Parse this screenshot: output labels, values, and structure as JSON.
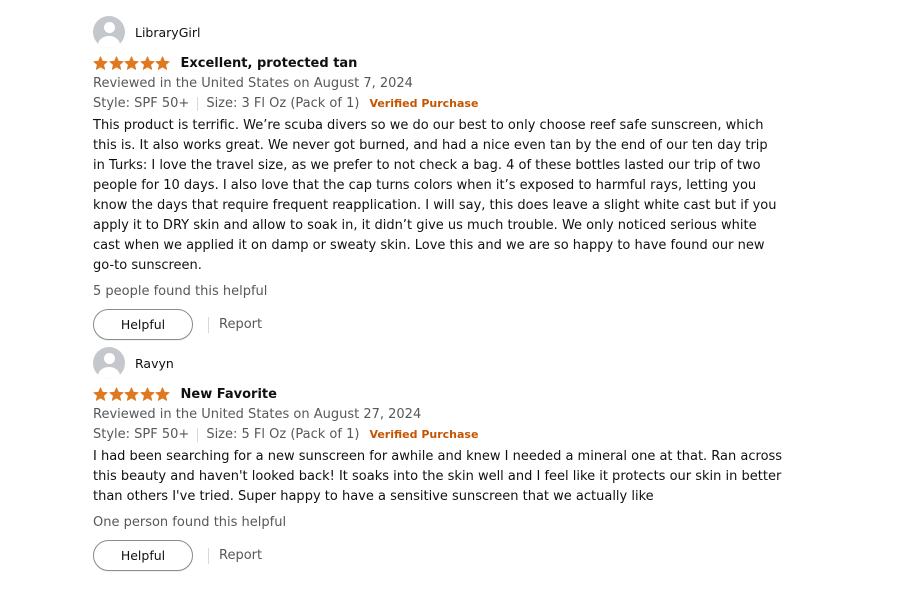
{
  "colors": {
    "star": "#de7921",
    "verified": "#c45500",
    "secondary_text": "#565959",
    "primary_text": "#0f1111"
  },
  "reviews": [
    {
      "reviewer": "LibraryGirl",
      "avatar_icon": "user-avatar-icon",
      "rating": 5,
      "rating_max": 5,
      "title": "Excellent, protected tan",
      "date_line": "Reviewed in the United States on August 7, 2024",
      "style": "Style: SPF 50+",
      "size": "Size: 3 Fl Oz (Pack of 1)",
      "verified": "Verified Purchase",
      "body": "This product is terrific. We’re scuba divers so we do our best to only choose reef safe sunscreen, which this is. It also works great. We never got burned, and had a nice even tan by the end of our ten day trip in Turks: I love the travel size, as we prefer to not check a bag. 4 of these bottles lasted our trip of two people for 10 days. I also love that the cap turns colors when it’s exposed to harmful rays, letting you know the days that require frequent reapplication. I will say, this does leave a slight white cast but if you apply it to DRY skin and allow to soak in, it didn’t give us much trouble. We only noticed serious white cast when we applied it on damp or sweaty skin. Love this and we are so happy to have found our new go-to sunscreen.",
      "helpful_count": "5 people found this helpful",
      "helpful_label": "Helpful",
      "report_label": "Report"
    },
    {
      "reviewer": "Ravyn",
      "avatar_icon": "user-avatar-icon",
      "rating": 5,
      "rating_max": 5,
      "title": "New Favorite",
      "date_line": "Reviewed in the United States on August 27, 2024",
      "style": "Style: SPF 50+",
      "size": "Size: 5 Fl Oz (Pack of 1)",
      "verified": "Verified Purchase",
      "body": "I had been searching for a new sunscreen for awhile and knew I needed a mineral one at that. Ran across this beauty and haven't looked back! It soaks into the skin well and I feel like it protects our skin in better than others I've tried. Super happy to have a sensitive sunscreen that we actually like",
      "helpful_count": "One person found this helpful",
      "helpful_label": "Helpful",
      "report_label": "Report"
    }
  ]
}
